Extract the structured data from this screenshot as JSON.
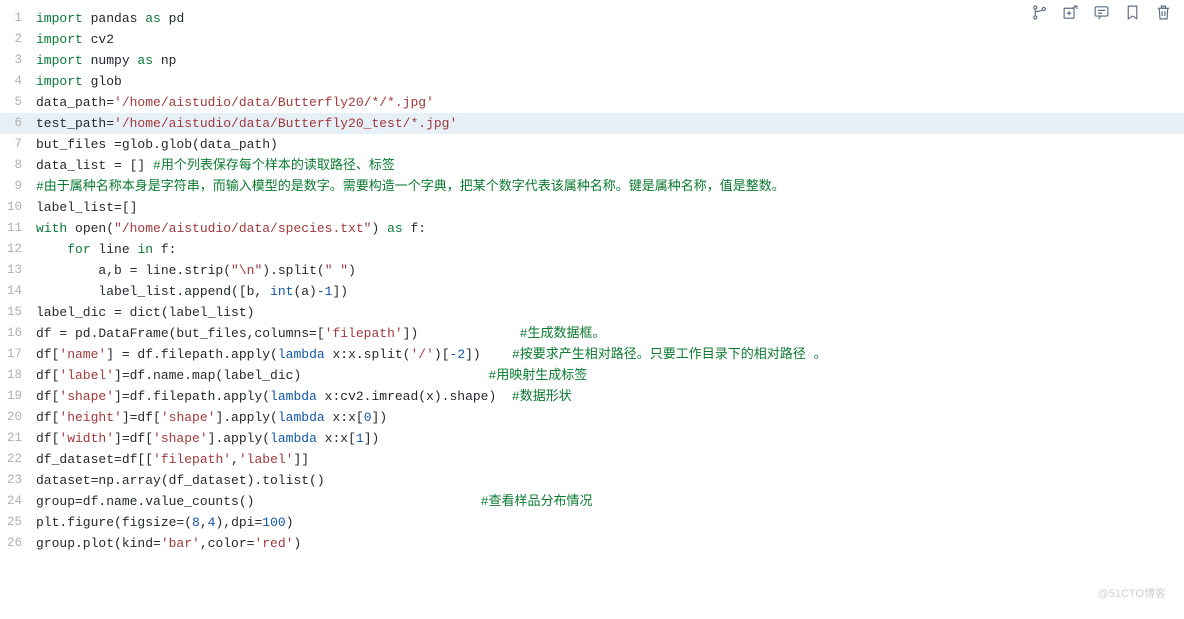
{
  "toolbar": {
    "icons": [
      {
        "name": "branch-icon"
      },
      {
        "name": "add-cell-icon"
      },
      {
        "name": "comment-icon"
      },
      {
        "name": "bookmark-icon"
      },
      {
        "name": "trash-icon"
      }
    ]
  },
  "watermark": "@51CTO博客",
  "code": {
    "lines": [
      {
        "n": "1",
        "tokens": [
          {
            "c": "kw",
            "t": "import"
          },
          {
            "c": "ident",
            "t": " pandas "
          },
          {
            "c": "kw",
            "t": "as"
          },
          {
            "c": "ident",
            "t": " pd"
          }
        ]
      },
      {
        "n": "2",
        "tokens": [
          {
            "c": "kw",
            "t": "import"
          },
          {
            "c": "ident",
            "t": " cv2"
          }
        ]
      },
      {
        "n": "3",
        "tokens": [
          {
            "c": "kw",
            "t": "import"
          },
          {
            "c": "ident",
            "t": " numpy "
          },
          {
            "c": "kw",
            "t": "as"
          },
          {
            "c": "ident",
            "t": " np"
          }
        ]
      },
      {
        "n": "4",
        "tokens": [
          {
            "c": "kw",
            "t": "import"
          },
          {
            "c": "ident",
            "t": " glob"
          }
        ]
      },
      {
        "n": "5",
        "tokens": [
          {
            "c": "ident",
            "t": "data_path="
          },
          {
            "c": "str",
            "t": "'/home/aistudio/data/Butterfly20/*/*.jpg'"
          }
        ]
      },
      {
        "n": "6",
        "hl": true,
        "tokens": [
          {
            "c": "ident",
            "t": "test_path="
          },
          {
            "c": "str",
            "t": "'/home/aistudio/data/Butterfly20_test/*.jpg'"
          }
        ]
      },
      {
        "n": "7",
        "tokens": [
          {
            "c": "ident",
            "t": "but_files =glob.glob(data_path)"
          }
        ]
      },
      {
        "n": "8",
        "tokens": [
          {
            "c": "ident",
            "t": "data_list = [] "
          },
          {
            "c": "cmt",
            "t": "#用个列表保存每个样本的读取路径、标签"
          }
        ]
      },
      {
        "n": "9",
        "tokens": [
          {
            "c": "cmt",
            "t": "#由于属种名称本身是字符串，而输入模型的是数字。需要构造一个字典，把某个数字代表该属种名称。键是属种名称，值是整数。"
          }
        ]
      },
      {
        "n": "10",
        "tokens": [
          {
            "c": "ident",
            "t": "label_list=[]"
          }
        ]
      },
      {
        "n": "11",
        "tokens": [
          {
            "c": "kw",
            "t": "with"
          },
          {
            "c": "ident",
            "t": " open("
          },
          {
            "c": "str",
            "t": "\"/home/aistudio/data/species.txt\""
          },
          {
            "c": "ident",
            "t": ") "
          },
          {
            "c": "kw",
            "t": "as"
          },
          {
            "c": "ident",
            "t": " f:"
          }
        ]
      },
      {
        "n": "12",
        "tokens": [
          {
            "c": "ident",
            "t": "    "
          },
          {
            "c": "kw",
            "t": "for"
          },
          {
            "c": "ident",
            "t": " line "
          },
          {
            "c": "kw",
            "t": "in"
          },
          {
            "c": "ident",
            "t": " f:"
          }
        ]
      },
      {
        "n": "13",
        "tokens": [
          {
            "c": "ident",
            "t": "        a,b = line.strip("
          },
          {
            "c": "str",
            "t": "\"\\n\""
          },
          {
            "c": "ident",
            "t": ").split("
          },
          {
            "c": "str",
            "t": "\" \""
          },
          {
            "c": "ident",
            "t": ")"
          }
        ]
      },
      {
        "n": "14",
        "tokens": [
          {
            "c": "ident",
            "t": "        label_list.append([b, "
          },
          {
            "c": "blue",
            "t": "int"
          },
          {
            "c": "ident",
            "t": "(a)"
          },
          {
            "c": "blue",
            "t": "-1"
          },
          {
            "c": "ident",
            "t": "])"
          }
        ]
      },
      {
        "n": "15",
        "tokens": [
          {
            "c": "ident",
            "t": "label_dic = dict(label_list)"
          }
        ]
      },
      {
        "n": "16",
        "tokens": [
          {
            "c": "ident",
            "t": "df = pd.DataFrame(but_files,columns=["
          },
          {
            "c": "str",
            "t": "'filepath'"
          },
          {
            "c": "ident",
            "t": "])             "
          },
          {
            "c": "cmt",
            "t": "#生成数据框。"
          }
        ]
      },
      {
        "n": "17",
        "tokens": [
          {
            "c": "ident",
            "t": "df["
          },
          {
            "c": "str",
            "t": "'name'"
          },
          {
            "c": "ident",
            "t": "] = df.filepath.apply("
          },
          {
            "c": "blue",
            "t": "lambda"
          },
          {
            "c": "ident",
            "t": " x:x.split("
          },
          {
            "c": "str",
            "t": "'/'"
          },
          {
            "c": "ident",
            "t": ")["
          },
          {
            "c": "blue",
            "t": "-2"
          },
          {
            "c": "ident",
            "t": "])    "
          },
          {
            "c": "cmt",
            "t": "#按要求产生相对路径。只要工作目录下的相对路径 。"
          }
        ]
      },
      {
        "n": "18",
        "tokens": [
          {
            "c": "ident",
            "t": "df["
          },
          {
            "c": "str",
            "t": "'label'"
          },
          {
            "c": "ident",
            "t": "]=df.name.map(label_dic)                        "
          },
          {
            "c": "cmt",
            "t": "#用映射生成标签"
          }
        ]
      },
      {
        "n": "19",
        "tokens": [
          {
            "c": "ident",
            "t": "df["
          },
          {
            "c": "str",
            "t": "'shape'"
          },
          {
            "c": "ident",
            "t": "]=df.filepath.apply("
          },
          {
            "c": "blue",
            "t": "lambda"
          },
          {
            "c": "ident",
            "t": " x:cv2.imread(x).shape)  "
          },
          {
            "c": "cmt",
            "t": "#数据形状"
          }
        ]
      },
      {
        "n": "20",
        "tokens": [
          {
            "c": "ident",
            "t": "df["
          },
          {
            "c": "str",
            "t": "'height'"
          },
          {
            "c": "ident",
            "t": "]=df["
          },
          {
            "c": "str",
            "t": "'shape'"
          },
          {
            "c": "ident",
            "t": "].apply("
          },
          {
            "c": "blue",
            "t": "lambda"
          },
          {
            "c": "ident",
            "t": " x:x["
          },
          {
            "c": "blue",
            "t": "0"
          },
          {
            "c": "ident",
            "t": "])"
          }
        ]
      },
      {
        "n": "21",
        "tokens": [
          {
            "c": "ident",
            "t": "df["
          },
          {
            "c": "str",
            "t": "'width'"
          },
          {
            "c": "ident",
            "t": "]=df["
          },
          {
            "c": "str",
            "t": "'shape'"
          },
          {
            "c": "ident",
            "t": "].apply("
          },
          {
            "c": "blue",
            "t": "lambda"
          },
          {
            "c": "ident",
            "t": " x:x["
          },
          {
            "c": "blue",
            "t": "1"
          },
          {
            "c": "ident",
            "t": "])"
          }
        ]
      },
      {
        "n": "22",
        "tokens": [
          {
            "c": "ident",
            "t": "df_dataset=df[["
          },
          {
            "c": "str",
            "t": "'filepath'"
          },
          {
            "c": "ident",
            "t": ","
          },
          {
            "c": "str",
            "t": "'label'"
          },
          {
            "c": "ident",
            "t": "]]"
          }
        ]
      },
      {
        "n": "23",
        "tokens": [
          {
            "c": "ident",
            "t": "dataset=np.array(df_dataset).tolist()"
          }
        ]
      },
      {
        "n": "24",
        "tokens": [
          {
            "c": "ident",
            "t": "group=df.name.value_counts()                             "
          },
          {
            "c": "cmt",
            "t": "#查看样品分布情况"
          }
        ]
      },
      {
        "n": "25",
        "tokens": [
          {
            "c": "ident",
            "t": "plt.figure(figsize=("
          },
          {
            "c": "blue",
            "t": "8"
          },
          {
            "c": "ident",
            "t": ","
          },
          {
            "c": "blue",
            "t": "4"
          },
          {
            "c": "ident",
            "t": "),dpi="
          },
          {
            "c": "blue",
            "t": "100"
          },
          {
            "c": "ident",
            "t": ")"
          }
        ]
      },
      {
        "n": "26",
        "tokens": [
          {
            "c": "ident",
            "t": "group.plot(kind="
          },
          {
            "c": "str",
            "t": "'bar'"
          },
          {
            "c": "ident",
            "t": ",color="
          },
          {
            "c": "str",
            "t": "'red'"
          },
          {
            "c": "ident",
            "t": ")"
          }
        ]
      }
    ]
  }
}
